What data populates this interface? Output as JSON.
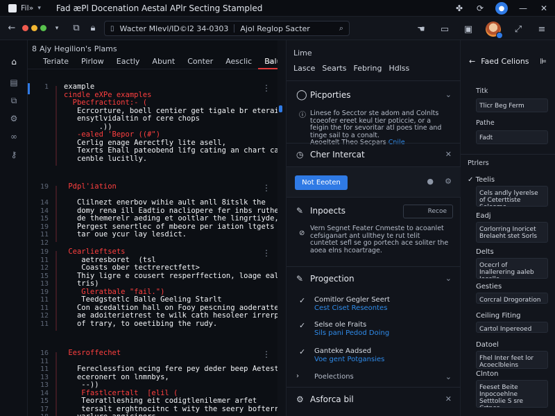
{
  "titlebar": {
    "menu": "Fil»",
    "title": "Fad æPl Docenation Aestal APlr Secting Stampled"
  },
  "toolbar": {
    "address_left": "Wacter Mlevl/ID©l2 34-0303",
    "address_right": "Ajol Reglop Sacter"
  },
  "editor": {
    "breadcrumb": [
      "8",
      "Ajy",
      "Hegilion's",
      "Plams"
    ],
    "tabs": [
      "Teriate",
      "Pirlow",
      "Eactly",
      "Abunt",
      "Conter",
      "Aesclic",
      "Balu"
    ],
    "blocks": [
      {
        "nums": [
          "1",
          "",
          "",
          "",
          "",
          "",
          "",
          "",
          "",
          "",
          "",
          "",
          ""
        ],
        "lines": [
          {
            "c": "c-white",
            "t": "example"
          },
          {
            "c": "c-red",
            "t": "cindle eXPe examples"
          },
          {
            "c": "c-red",
            "t": "  Pbecfractiont:- ("
          },
          {
            "c": "c-white",
            "t": "   Ecrcorture, boell centier get tigale br eteraing is"
          },
          {
            "c": "c-white",
            "t": "   ensytlvidaltin of cere chops"
          },
          {
            "c": "c-white",
            "t": "        .))"
          },
          {
            "c": "c-red",
            "t": "   -ealed 'Bepor ((#\")"
          },
          {
            "c": "c-white",
            "t": "   Cerlig enage Aerectfly lite asell,"
          },
          {
            "c": "c-white",
            "t": "   Texrts Ehall pateobend lifg cating an chart cand"
          },
          {
            "c": "c-white",
            "t": "   cenble lucitlly."
          }
        ]
      },
      {
        "nums": [
          "19",
          "",
          "14",
          "14",
          "15",
          "19",
          "11",
          "12"
        ],
        "lines": [
          {
            "c": "c-red",
            "t": " Pdpl'iation"
          },
          {
            "c": "c-white",
            "t": ""
          },
          {
            "c": "c-white",
            "t": "   Clilnezt enerbov wihie ault anll 8itslk the"
          },
          {
            "c": "c-white",
            "t": "   domy rena ill Eadtio nacliopere fer inbs ruther"
          },
          {
            "c": "c-white",
            "t": "   de themerelr aeding et ooltlar the lingrtiyde,"
          },
          {
            "c": "c-white",
            "t": "   Pergest senertlec of mbeore per iation ltgets und"
          },
          {
            "c": "c-white",
            "t": "   tar oue ycur lay lesdict."
          }
        ]
      },
      {
        "nums": [
          "19",
          "11",
          "12",
          "15",
          "13",
          "19",
          "11",
          "11",
          "12",
          "11"
        ],
        "lines": [
          {
            "c": "c-red",
            "t": " Cearlieftsets"
          },
          {
            "c": "c-white",
            "t": "    aetresboret  (tsl"
          },
          {
            "c": "c-white",
            "t": "    Coasts ober tectrerectfett>"
          },
          {
            "c": "c-white",
            "t": "   Thiy ligre e cousert resperffection, loage ealt up"
          },
          {
            "c": "c-white",
            "t": "   tris)"
          },
          {
            "c": "c-red",
            "t": "    Gleratbale \"fail.\")"
          },
          {
            "c": "c-white",
            "t": "    Teedgstetlc Balle Geeling Starlt"
          },
          {
            "c": "c-white",
            "t": "   Con acedaltion hall on Fooy pescning aoderatte,"
          },
          {
            "c": "c-white",
            "t": "   ae adoiterietrest te wilk cath hesoleer irrerpratins"
          },
          {
            "c": "c-white",
            "t": "   of trary, to oeetibing the rudy."
          }
        ]
      },
      {
        "nums": [
          "16",
          "11",
          "11",
          "13",
          "13",
          "14",
          "15",
          "17",
          "18"
        ],
        "lines": [
          {
            "c": "c-red",
            "t": " Eesroffechet"
          },
          {
            "c": "c-white",
            "t": ""
          },
          {
            "c": "c-white",
            "t": "   Fereclessfion ecing fere pey deder beep Aetest hat"
          },
          {
            "c": "c-white",
            "t": "   eceronert on lnmnbys,"
          },
          {
            "c": "c-white",
            "t": "    --))"
          },
          {
            "c": "c-red",
            "t": "    Ffastlcertalt  [elil ("
          },
          {
            "c": "c-white",
            "t": "    Teoratlleshing eit codigtlenilemer arfet"
          },
          {
            "c": "c-white",
            "t": "    tersalt erghtnocitnc t wity the seery bofterree of"
          },
          {
            "c": "c-white",
            "t": "   varlure angicipers."
          }
        ]
      }
    ]
  },
  "mid": {
    "header": "Lime",
    "tabs": [
      "Lasce",
      "Searts",
      "Febring",
      "Hdlss"
    ],
    "properties": {
      "title": "Picporties",
      "body": "Linese fo Secctor ste adom and Colnlts tcoeofer ereet keul tier poticcie, or a feigin the for sevoritar atl poes tine and tinge sail to a conalt.",
      "link_prefix": "Aeoeltelt Theo Secpars",
      "link": "Cnile"
    },
    "current": {
      "title": "Cher Intercat",
      "button": "Not Eeoten"
    },
    "inspects": {
      "title": "Inpoects",
      "mini_button": "Recoe",
      "body": "Vern Segnet Feater Cnmeste to acoanlet cefsiganart ant ullthey te rut telit cuntetet sefl se go portech ace soliter the aoea elns hcoartrage."
    },
    "projection": {
      "title": "Progection",
      "items": [
        {
          "t1": "Comitlor Gegler Seert",
          "t2": "Cest Ciset Reseontes"
        },
        {
          "t1": "Selse ole Fraits",
          "t2": "Sils pani Pedod Doing"
        },
        {
          "t1": "Ganteke Aadsed",
          "t2": "Voe gent Potgansies"
        }
      ],
      "footer": "Poelections"
    },
    "bottom": {
      "title": "Asforca bil"
    }
  },
  "right": {
    "header": "Faed Celions",
    "fields": [
      {
        "label": "Titk",
        "value": "Tlicr Beg Ferm"
      },
      {
        "label": "Pathe",
        "value": "Fadt"
      }
    ],
    "section": "Ptrlers",
    "items": [
      {
        "label": "Teelis",
        "value": "Cels andly lyerelse of Ceterttiste Seleome"
      },
      {
        "label": "Eadj",
        "value": "Corlorring Inoricet Brelaeht stet Sorls"
      },
      {
        "label": "Delts",
        "value": "Ocecrl of Inallerering aaleb Iecelle"
      },
      {
        "label": "Gesties",
        "value": "Corcral Drogoration"
      },
      {
        "label": "Ceiling Fiting",
        "value": "Cartol Inpereoed"
      },
      {
        "label": "Datoel",
        "value": "Fhel Inter feet lor Acoeclbleins"
      },
      {
        "label": "Clnton",
        "value": "Feeset Beite Inpocoehlne Setttolie S sre Crtnes"
      }
    ]
  }
}
